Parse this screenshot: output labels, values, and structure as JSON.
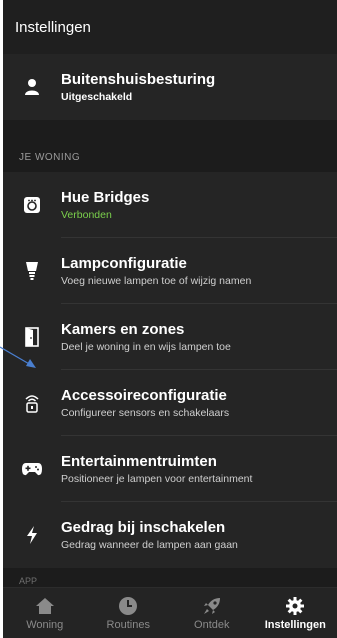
{
  "header": {
    "title": "Instellingen"
  },
  "top_item": {
    "title": "Buitenshuisbesturing",
    "subtitle": "Uitgeschakeld"
  },
  "section": {
    "title": "JE WONING"
  },
  "items": [
    {
      "title": "Hue Bridges",
      "subtitle": "Verbonden"
    },
    {
      "title": "Lampconfiguratie",
      "subtitle": "Voeg nieuwe lampen toe of wijzig namen"
    },
    {
      "title": "Kamers en zones",
      "subtitle": "Deel je woning in en wijs lampen toe"
    },
    {
      "title": "Accessoireconfiguratie",
      "subtitle": "Configureer sensors en schakelaars"
    },
    {
      "title": "Entertainmentruimten",
      "subtitle": "Positioneer je lampen voor entertainment"
    },
    {
      "title": "Gedrag bij inschakelen",
      "subtitle": "Gedrag wanneer de lampen aan gaan"
    }
  ],
  "next_section": {
    "title": "APP"
  },
  "tabs": [
    {
      "label": "Woning",
      "icon": "home-icon"
    },
    {
      "label": "Routines",
      "icon": "clock-icon"
    },
    {
      "label": "Ontdek",
      "icon": "rocket-icon"
    },
    {
      "label": "Instellingen",
      "icon": "gear-icon"
    }
  ],
  "colors": {
    "accent_green": "#7bd04c",
    "arrow_blue": "#4a7fd0"
  }
}
